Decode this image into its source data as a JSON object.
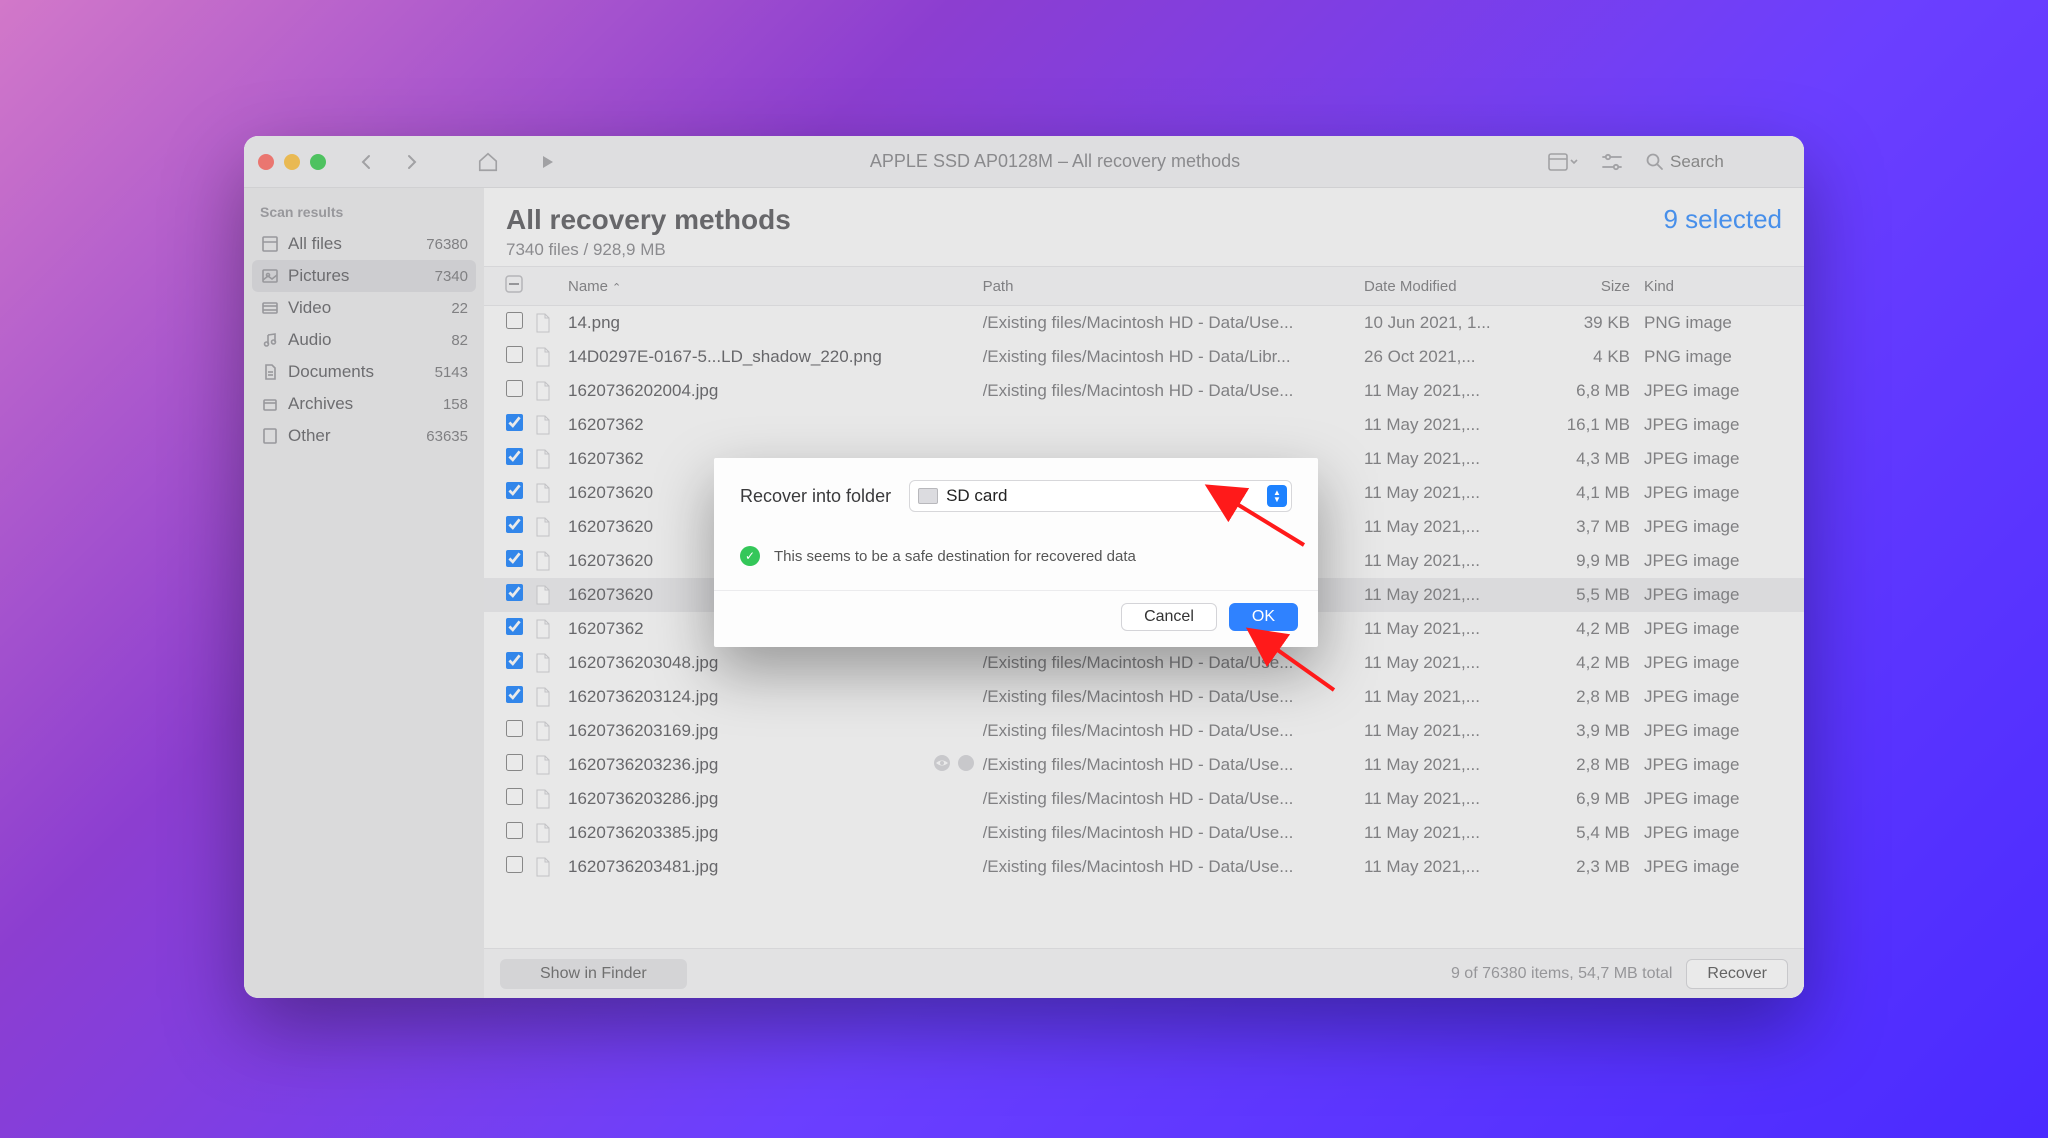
{
  "titlebar": {
    "title": "APPLE SSD AP0128M – All recovery methods",
    "search_placeholder": "Search"
  },
  "sidebar": {
    "header": "Scan results",
    "items": [
      {
        "icon": "files",
        "label": "All files",
        "count": "76380"
      },
      {
        "icon": "pictures",
        "label": "Pictures",
        "count": "7340",
        "active": true
      },
      {
        "icon": "video",
        "label": "Video",
        "count": "22"
      },
      {
        "icon": "audio",
        "label": "Audio",
        "count": "82"
      },
      {
        "icon": "documents",
        "label": "Documents",
        "count": "5143"
      },
      {
        "icon": "archives",
        "label": "Archives",
        "count": "158"
      },
      {
        "icon": "other",
        "label": "Other",
        "count": "63635"
      }
    ]
  },
  "main": {
    "title": "All recovery methods",
    "subtitle": "7340 files / 928,9 MB",
    "selected_label": "9 selected"
  },
  "columns": {
    "name": "Name",
    "path": "Path",
    "date": "Date Modified",
    "size": "Size",
    "kind": "Kind"
  },
  "rows": [
    {
      "checked": false,
      "name": "14.png",
      "path": "/Existing files/Macintosh HD - Data/Use...",
      "date": "10 Jun 2021, 1...",
      "size": "39 KB",
      "kind": "PNG image"
    },
    {
      "checked": false,
      "name": "14D0297E-0167-5...LD_shadow_220.png",
      "path": "/Existing files/Macintosh HD - Data/Libr...",
      "date": "26 Oct 2021,...",
      "size": "4 KB",
      "kind": "PNG image"
    },
    {
      "checked": false,
      "name": "1620736202004.jpg",
      "path": "/Existing files/Macintosh HD - Data/Use...",
      "date": "11 May 2021,...",
      "size": "6,8 MB",
      "kind": "JPEG image"
    },
    {
      "checked": true,
      "name": "16207362",
      "path": "",
      "date": "11 May 2021,...",
      "size": "16,1 MB",
      "kind": "JPEG image"
    },
    {
      "checked": true,
      "name": "16207362",
      "path": "",
      "date": "11 May 2021,...",
      "size": "4,3 MB",
      "kind": "JPEG image"
    },
    {
      "checked": true,
      "name": "162073620",
      "path": "",
      "date": "11 May 2021,...",
      "size": "4,1 MB",
      "kind": "JPEG image"
    },
    {
      "checked": true,
      "name": "162073620",
      "path": "",
      "date": "11 May 2021,...",
      "size": "3,7 MB",
      "kind": "JPEG image"
    },
    {
      "checked": true,
      "name": "162073620",
      "path": "",
      "date": "11 May 2021,...",
      "size": "9,9 MB",
      "kind": "JPEG image"
    },
    {
      "checked": true,
      "name": "162073620",
      "path": "",
      "date": "11 May 2021,...",
      "size": "5,5 MB",
      "kind": "JPEG image",
      "selected_row": true
    },
    {
      "checked": true,
      "name": "16207362",
      "path": "",
      "date": "11 May 2021,...",
      "size": "4,2 MB",
      "kind": "JPEG image"
    },
    {
      "checked": true,
      "name": "1620736203048.jpg",
      "path": "/Existing files/Macintosh HD - Data/Use...",
      "date": "11 May 2021,...",
      "size": "4,2 MB",
      "kind": "JPEG image"
    },
    {
      "checked": true,
      "name": "1620736203124.jpg",
      "path": "/Existing files/Macintosh HD - Data/Use...",
      "date": "11 May 2021,...",
      "size": "2,8 MB",
      "kind": "JPEG image"
    },
    {
      "checked": false,
      "name": "1620736203169.jpg",
      "path": "/Existing files/Macintosh HD - Data/Use...",
      "date": "11 May 2021,...",
      "size": "3,9 MB",
      "kind": "JPEG image"
    },
    {
      "checked": false,
      "name": "1620736203236.jpg",
      "path": "/Existing files/Macintosh HD - Data/Use...",
      "date": "11 May 2021,...",
      "size": "2,8 MB",
      "kind": "JPEG image",
      "badges": true
    },
    {
      "checked": false,
      "name": "1620736203286.jpg",
      "path": "/Existing files/Macintosh HD - Data/Use...",
      "date": "11 May 2021,...",
      "size": "6,9 MB",
      "kind": "JPEG image"
    },
    {
      "checked": false,
      "name": "1620736203385.jpg",
      "path": "/Existing files/Macintosh HD - Data/Use...",
      "date": "11 May 2021,...",
      "size": "5,4 MB",
      "kind": "JPEG image"
    },
    {
      "checked": false,
      "name": "1620736203481.jpg",
      "path": "/Existing files/Macintosh HD - Data/Use...",
      "date": "11 May 2021,...",
      "size": "2,3 MB",
      "kind": "JPEG image"
    }
  ],
  "footer": {
    "show_in_finder": "Show in Finder",
    "status": "9 of 76380 items, 54,7 MB total",
    "recover": "Recover"
  },
  "modal": {
    "label": "Recover into folder",
    "destination": "SD card",
    "message": "This seems to be a safe destination for recovered data",
    "cancel": "Cancel",
    "ok": "OK"
  }
}
